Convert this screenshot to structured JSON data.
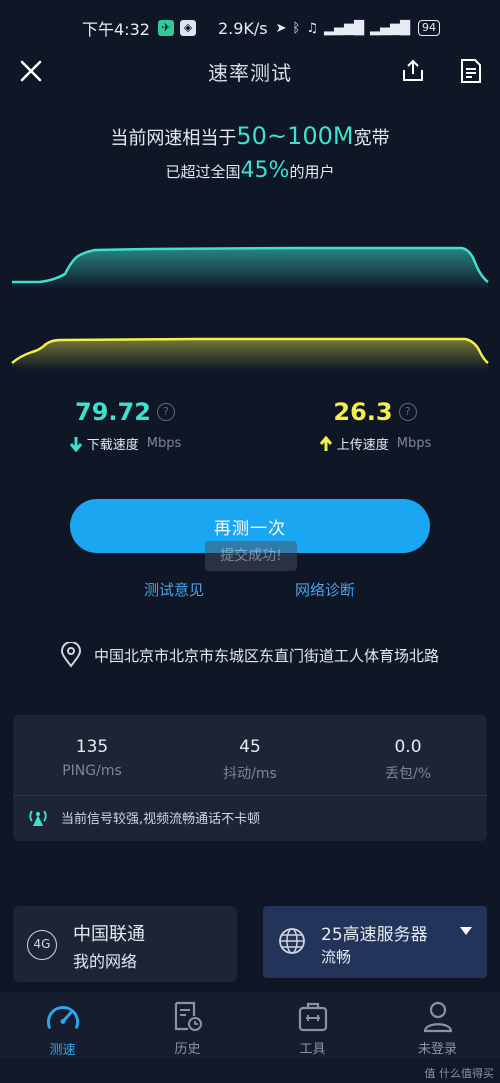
{
  "status_bar": {
    "time": "下午4:32",
    "net_speed": "2.9K/s",
    "battery": "94"
  },
  "top_bar": {
    "title": "速率测试",
    "icons": [
      "close-icon",
      "share-icon",
      "document-icon"
    ]
  },
  "summary": {
    "headline_prefix": "当前网速相当于",
    "headline_value": "50~100M",
    "headline_suffix": "宽带",
    "sub_prefix": "已超过全国",
    "sub_value": "45%",
    "sub_suffix": "的用户"
  },
  "download": {
    "value": "79.72",
    "label": "下载速度",
    "unit": "Mbps",
    "color": "#3ee0cf"
  },
  "upload": {
    "value": "26.3",
    "label": "上传速度",
    "unit": "Mbps",
    "color": "#f3f04a"
  },
  "retest_button": "再测一次",
  "toast": "提交成功!",
  "links": {
    "feedback": "测试意见",
    "diagnose": "网络诊断"
  },
  "location": "中国北京市北京市东城区东直门街道工人体育场北路",
  "stats": [
    {
      "value": "135",
      "label": "PING/ms"
    },
    {
      "value": "45",
      "label": "抖动/ms"
    },
    {
      "value": "0.0",
      "label": "丢包/%"
    }
  ],
  "signal_message": "当前信号较强,视频流畅通话不卡顿",
  "network": {
    "badge": "4G",
    "carrier": "中国联通",
    "subtitle": "我的网络"
  },
  "server": {
    "name": "25高速服务器",
    "status": "流畅"
  },
  "bottom_nav": [
    {
      "label": "测速",
      "icon": "speedometer-icon",
      "active": true
    },
    {
      "label": "历史",
      "icon": "history-icon",
      "active": false
    },
    {
      "label": "工具",
      "icon": "toolbox-icon",
      "active": false
    },
    {
      "label": "未登录",
      "icon": "user-icon",
      "active": false
    }
  ],
  "watermark": "值 什么值得买",
  "colors": {
    "accent": "#1aa6f0",
    "background": "#0f1626",
    "card": "#1c2436"
  }
}
